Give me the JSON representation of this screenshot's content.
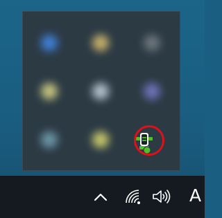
{
  "tray_flyout": {
    "hidden_icons": [
      {
        "name": "blurred-tray-icon-1",
        "color": "#3f7fd6"
      },
      {
        "name": "blurred-tray-icon-2",
        "color": "#c5b06a"
      },
      {
        "name": "blurred-tray-icon-3",
        "color": "#6c757b"
      },
      {
        "name": "blurred-tray-icon-4",
        "color": "#c5c47f"
      },
      {
        "name": "blurred-tray-icon-5",
        "color": "#b3c0cc"
      },
      {
        "name": "blurred-tray-icon-6",
        "color": "#6f72b8"
      },
      {
        "name": "blurred-tray-icon-7",
        "color": "#6b95a7"
      },
      {
        "name": "blurred-tray-icon-8",
        "color": "#c4c66a"
      }
    ],
    "highlighted_icon": {
      "icon": "gpu-monitor-icon",
      "color": "#4fc02a",
      "highlight_color": "#e0101a"
    }
  },
  "taskbar": {
    "show_hidden_icons": {
      "icon": "chevron-up-icon"
    },
    "network": {
      "icon": "wifi-icon"
    },
    "volume": {
      "icon": "speaker-volume-icon"
    },
    "clock_partial": "A"
  },
  "colors": {
    "desktop_bg": "#1a5f82",
    "flyout_bg": "#2c3a44",
    "taskbar_bg": "#141a1f",
    "tray_icon_fg": "#ffffff"
  }
}
